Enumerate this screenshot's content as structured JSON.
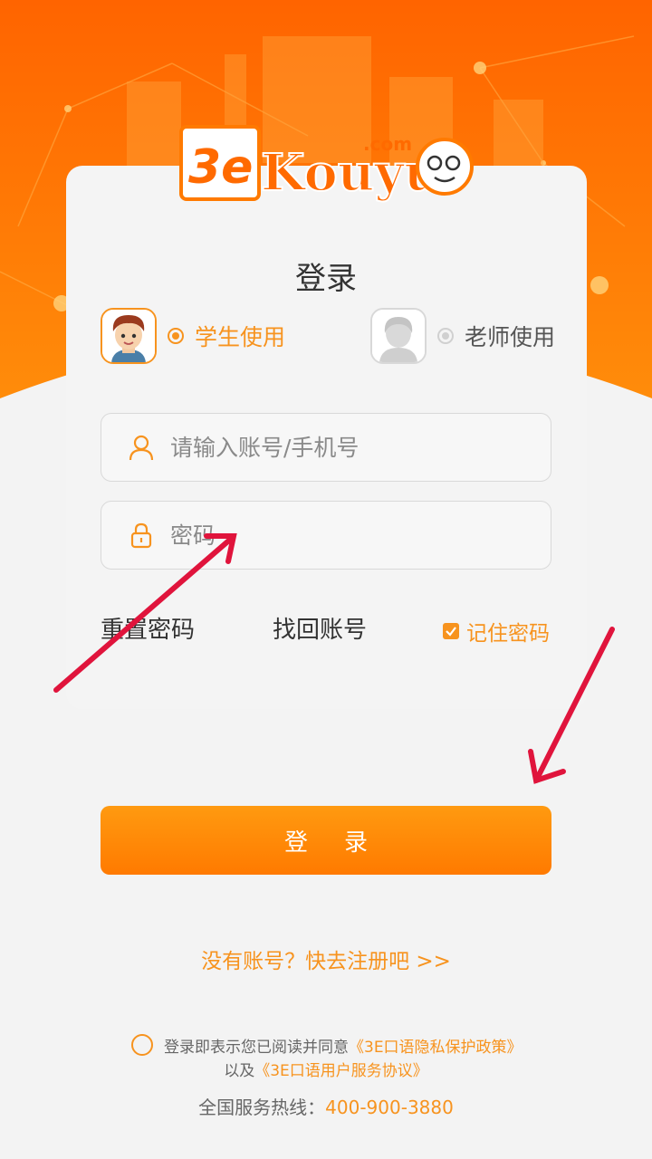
{
  "brand": {
    "logo_mark": "3e",
    "logo_name": "Kouyu",
    "logo_domain": ".com"
  },
  "title": "登录",
  "roles": {
    "student": {
      "label": "学生使用",
      "selected": true
    },
    "teacher": {
      "label": "老师使用",
      "selected": false
    }
  },
  "form": {
    "account_placeholder": "请输入账号/手机号",
    "password_placeholder": "密码",
    "account_icon": "user-icon",
    "password_icon": "lock-icon"
  },
  "links": {
    "reset_password": "重置密码",
    "find_account": "找回账号",
    "remember_password": "记住密码",
    "remember_checked": true
  },
  "login_button": "登录",
  "register_link": "没有账号？快去注册吧 >>",
  "agreement": {
    "prefix": "登录即表示您已阅读并同意",
    "privacy_policy": "《3E口语隐私保护政策》",
    "conjunction": "以及",
    "user_agreement": "《3E口语用户服务协议》"
  },
  "hotline": {
    "label": "全国服务热线：",
    "number": "400-900-3880"
  },
  "colors": {
    "accent": "#f7931e",
    "hero": "#ff6a00",
    "annotation": "#e0143c"
  }
}
